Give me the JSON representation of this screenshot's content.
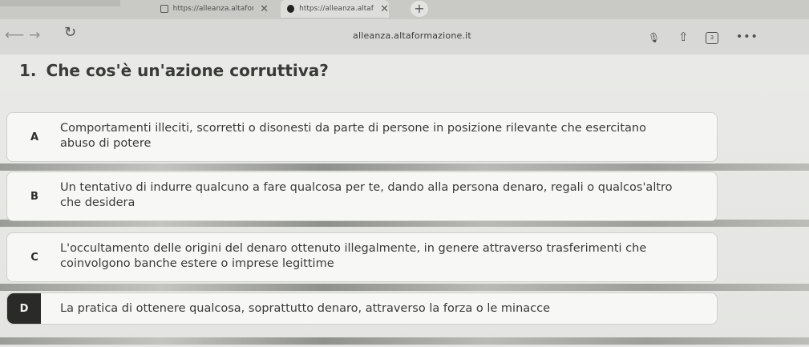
{
  "browser": {
    "tabs": [
      {
        "title": "https://alleanza.altaforr"
      },
      {
        "title": "https://alleanza.altafor"
      }
    ],
    "close_glyph": "✕",
    "new_tab_glyph": "+",
    "address": "alleanza.altaformazione.it",
    "tab_count": "3",
    "icons": {
      "back": "back-arrow-icon",
      "forward": "forward-arrow-icon",
      "reload": "reload-icon",
      "mic": "microphone-icon",
      "share": "share-icon",
      "tabs": "tabs-icon",
      "more": "more-icon"
    }
  },
  "question": {
    "number": "1.",
    "text": "Che cos'è un'azione corruttiva?"
  },
  "options": [
    {
      "letter": "A",
      "text": "Comportamenti illeciti, scorretti o disonesti da parte di persone in posizione rilevante che esercitano abuso di potere"
    },
    {
      "letter": "B",
      "text": "Un tentativo di indurre qualcuno a fare qualcosa per te, dando alla persona denaro, regali o qualcos'altro che desidera"
    },
    {
      "letter": "C",
      "text": "L'occultamento delle origini del denaro ottenuto illegalmente, in genere attraverso trasferimenti che coinvolgono banche estere o imprese legittime"
    },
    {
      "letter": "D",
      "text": "La pratica di ottenere qualcosa, soprattutto denaro, attraverso la forza o le minacce"
    }
  ]
}
